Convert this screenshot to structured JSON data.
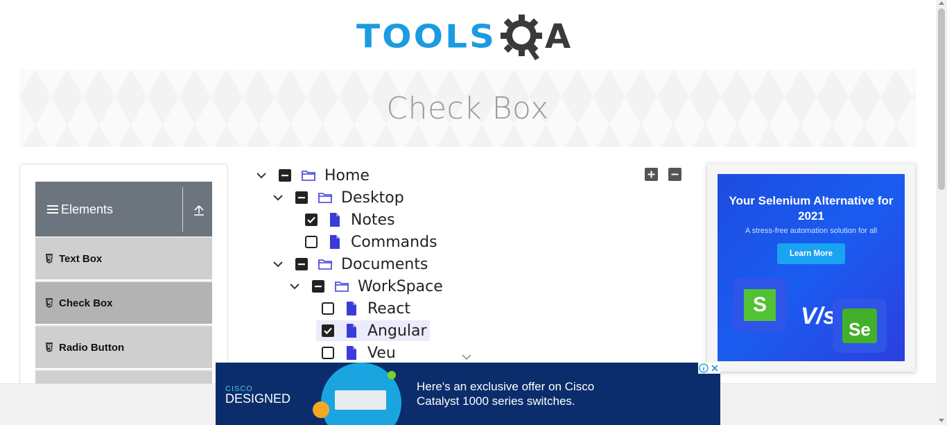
{
  "header": {
    "logo_text_left": "TOOLS",
    "logo_text_right": "A"
  },
  "banner": {
    "title": "Check Box"
  },
  "sidebar": {
    "group_title": "Elements",
    "items": [
      {
        "label": "Text Box",
        "active": false
      },
      {
        "label": "Check Box",
        "active": true
      },
      {
        "label": "Radio Button",
        "active": false
      }
    ]
  },
  "tree": {
    "nodes": [
      {
        "label": "Home",
        "state": "partial",
        "type": "folder",
        "expanded": true
      },
      {
        "label": "Desktop",
        "state": "partial",
        "type": "folder",
        "expanded": true
      },
      {
        "label": "Notes",
        "state": "checked",
        "type": "file"
      },
      {
        "label": "Commands",
        "state": "unchecked",
        "type": "file"
      },
      {
        "label": "Documents",
        "state": "partial",
        "type": "folder",
        "expanded": true
      },
      {
        "label": "WorkSpace",
        "state": "partial",
        "type": "folder",
        "expanded": true
      },
      {
        "label": "React",
        "state": "unchecked",
        "type": "file"
      },
      {
        "label": "Angular",
        "state": "checked",
        "type": "file",
        "highlighted": true
      },
      {
        "label": "Veu",
        "state": "unchecked",
        "type": "file"
      }
    ],
    "expand_all_icon": "plus-square-icon",
    "collapse_all_icon": "minus-square-icon"
  },
  "right_ad": {
    "headline": "Your Selenium Alternative for 2021",
    "subline": "A stress-free automation solution for all",
    "button": "Learn More",
    "vs": "V/s",
    "left_logo": "S",
    "right_logo": "Se"
  },
  "bottom_ad": {
    "brand_top": "CISCO",
    "brand_bottom": "DESIGNED",
    "text": "Here's an exclusive offer on Cisco Catalyst 1000 series switches."
  },
  "colors": {
    "accent_blue": "#1b9be0",
    "sidebar_header": "#6c757d",
    "icon_blue": "#3b3bd8",
    "highlight": "#ebebfb"
  }
}
